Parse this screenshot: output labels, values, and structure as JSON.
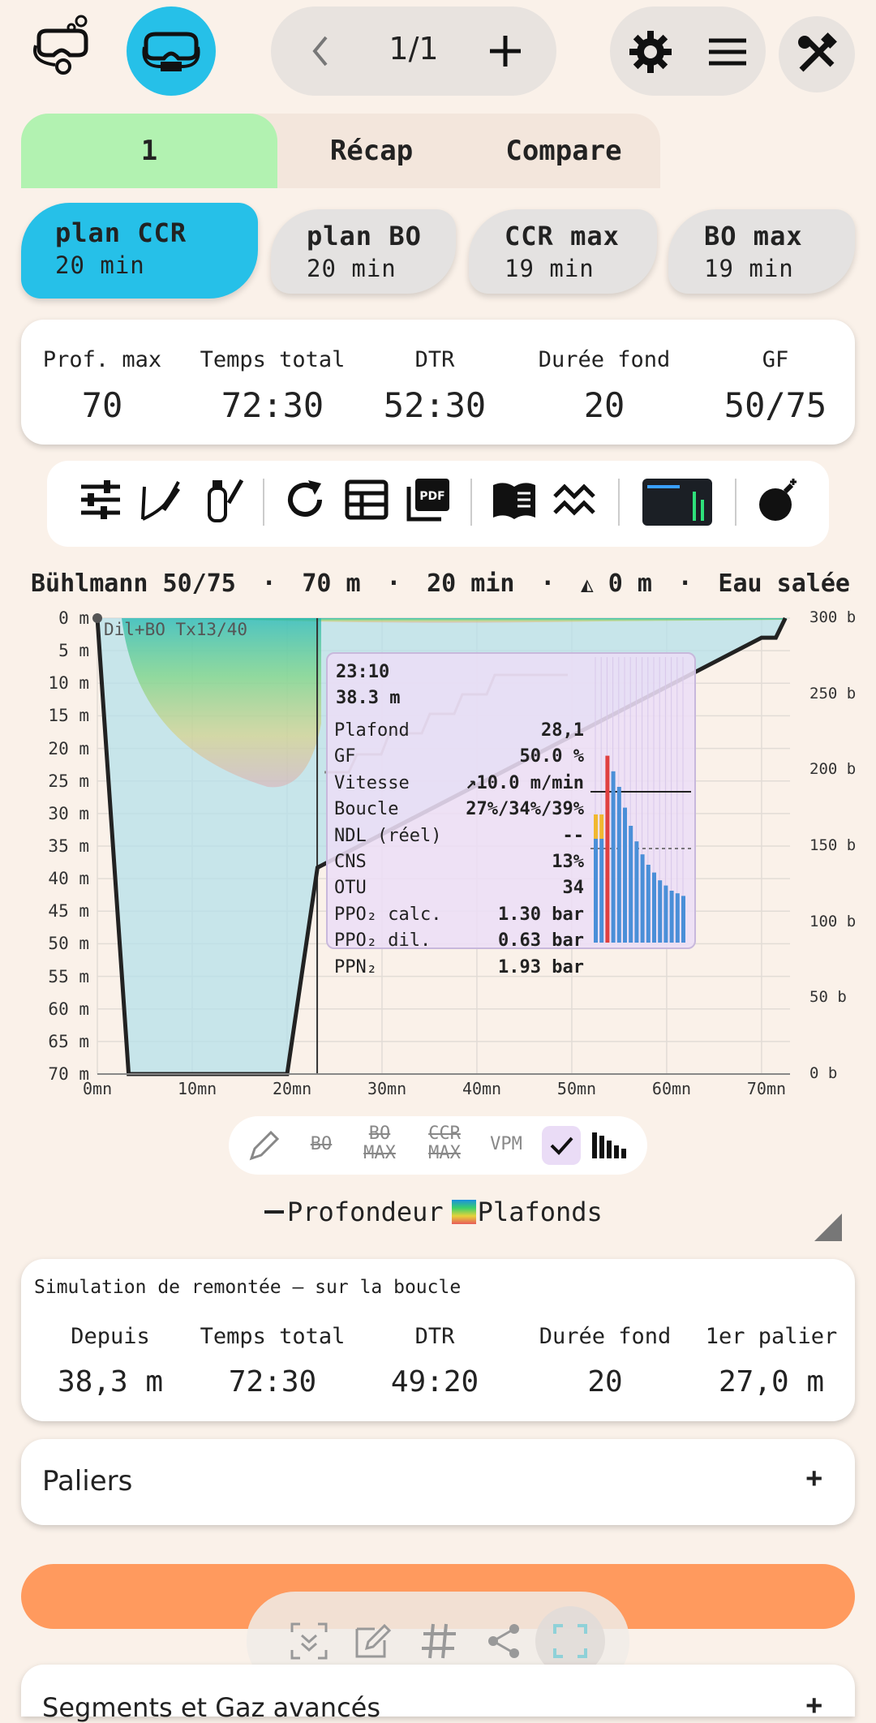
{
  "topbar": {
    "page_indicator": "1/1",
    "prev_icon": "chevron-left-icon",
    "add_icon": "plus-icon",
    "settings_icon": "gear-icon",
    "menu_icon": "hamburger-icon",
    "tools_icon": "tools-icon"
  },
  "tabs": [
    {
      "label": "1",
      "active": true
    },
    {
      "label": "Récap",
      "active": false
    },
    {
      "label": "Compare",
      "active": false
    }
  ],
  "plans": [
    {
      "name": "plan CCR",
      "duration": "20 min",
      "active": true
    },
    {
      "name": "plan BO",
      "duration": "20 min",
      "active": false
    },
    {
      "name": "CCR max",
      "duration": "19 min",
      "active": false
    },
    {
      "name": "BO max",
      "duration": "19 min",
      "active": false
    }
  ],
  "summary": [
    {
      "label": "Prof. max",
      "value": "70"
    },
    {
      "label": "Temps total",
      "value": "72:30"
    },
    {
      "label": "DTR",
      "value": "52:30"
    },
    {
      "label": "Durée fond",
      "value": "20"
    },
    {
      "label": "GF",
      "value": "50/75"
    }
  ],
  "chart_header": {
    "algo": "Bühlmann 50/75",
    "sep": "·",
    "depth": "70 m",
    "time": "20 min",
    "altitude": "0 m",
    "water": "Eau salée"
  },
  "chart": {
    "gas_label": "Dil+BO Tx13/40",
    "y_labels": [
      "0 m",
      "5 m",
      "10 m",
      "15 m",
      "20 m",
      "25 m",
      "30 m",
      "35 m",
      "40 m",
      "45 m",
      "50 m",
      "55 m",
      "60 m",
      "65 m",
      "70 m"
    ],
    "x_labels": [
      "0mn",
      "10mn",
      "20mn",
      "30mn",
      "40mn",
      "50mn",
      "60mn",
      "70mn"
    ],
    "r_labels": [
      "300 b",
      "250 b",
      "200 b",
      "150 b",
      "100 b",
      "50 b",
      "0 b"
    ],
    "colors": {
      "profile": "#222222",
      "fill": "#b5e0ea",
      "accent": "#26c0e8"
    }
  },
  "chart_data": {
    "type": "line",
    "xlabel": "",
    "ylabel": "",
    "xlim": [
      0,
      73
    ],
    "ylim": [
      70,
      0
    ],
    "y2lim": [
      0,
      300
    ],
    "series": [
      {
        "name": "Profondeur",
        "x": [
          0,
          3.3,
          20,
          23.2,
          70,
          71.5,
          72.5
        ],
        "y": [
          0,
          70,
          70,
          38.3,
          3,
          3,
          0
        ]
      }
    ],
    "cursor": {
      "x": 23.17,
      "y": 38.3
    }
  },
  "tooltip": {
    "time": "23:10",
    "depth": "38.3 m",
    "rows": [
      {
        "k": "Plafond",
        "v": "28,1"
      },
      {
        "k": "GF",
        "v": "50.0 %"
      },
      {
        "k": "Vitesse",
        "v": "↗10.0 m/min"
      },
      {
        "k": "Boucle",
        "v": "27%/34%/39%"
      },
      {
        "k": "NDL (réel)",
        "v": "--"
      },
      {
        "k": "CNS",
        "v": "13%"
      },
      {
        "k": "OTU",
        "v": "34"
      },
      {
        "k": "PPO₂ calc.",
        "v": "1.30 bar"
      },
      {
        "k": "PPO₂ dil.",
        "v": "0.63 bar"
      },
      {
        "k": "PPN₂",
        "v": "1.93 bar"
      }
    ],
    "tissue_bars": [
      0.4,
      0.4,
      0.72,
      0.66,
      0.6,
      0.52,
      0.45,
      0.39,
      0.34,
      0.3,
      0.27,
      0.24,
      0.22,
      0.2,
      0.19,
      0.18
    ]
  },
  "options": [
    {
      "l1": "BO",
      "l2": ""
    },
    {
      "l1": "BO",
      "l2": "MAX"
    },
    {
      "l1": "CCR",
      "l2": "MAX"
    },
    {
      "l1": "VPM",
      "l2": ""
    }
  ],
  "legend": {
    "depth": "Profondeur",
    "ceilings": "Plafonds"
  },
  "simulation": {
    "title": "Simulation de remontée – sur la boucle",
    "stats": [
      {
        "label": "Depuis",
        "value": "38,3 m"
      },
      {
        "label": "Temps total",
        "value": "72:30"
      },
      {
        "label": "DTR",
        "value": "49:20"
      },
      {
        "label": "Durée fond",
        "value": "20"
      },
      {
        "label": "1er palier",
        "value": "27,0 m"
      }
    ]
  },
  "stops": {
    "label": "Paliers",
    "toggle": "+"
  },
  "segments": {
    "label": "Segments et Gaz avancés",
    "toggle": "+"
  }
}
